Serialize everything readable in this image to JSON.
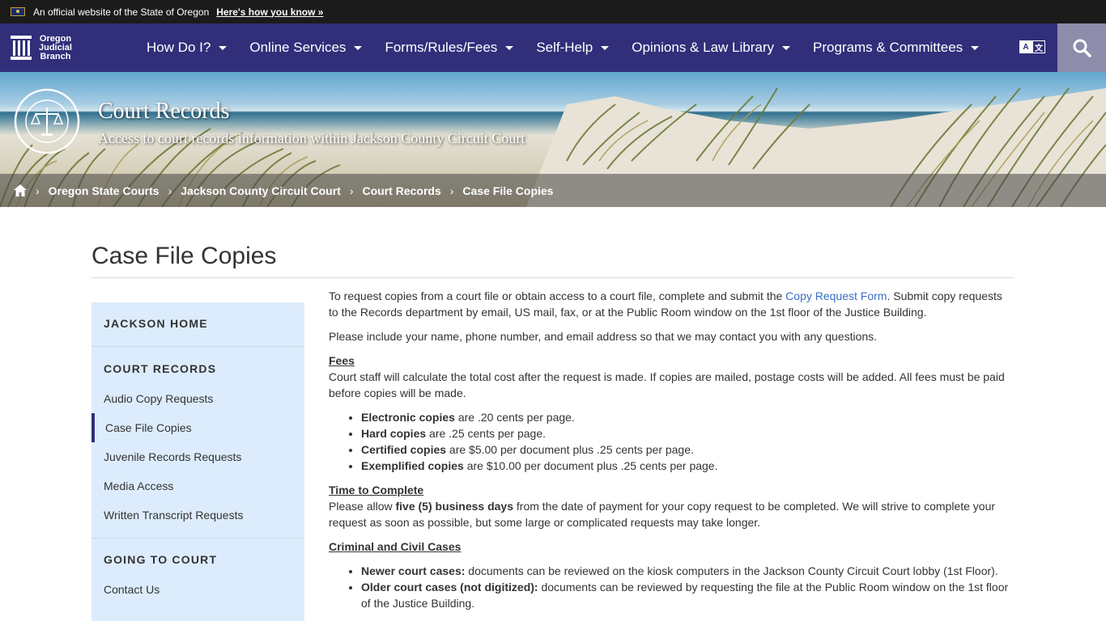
{
  "official": {
    "text": "An official website of the State of Oregon",
    "how": "Here's how you know »"
  },
  "logo": {
    "line1": "Oregon",
    "line2": "Judicial",
    "line3": "Branch"
  },
  "nav": [
    "How Do I?",
    "Online Services",
    "Forms/Rules/Fees",
    "Self-Help",
    "Opinions & Law Library",
    "Programs & Committees"
  ],
  "hero": {
    "title": "Court Records",
    "subtitle": "Access to court records information within Jackson County Circuit Court"
  },
  "breadcrumb": [
    "Oregon State Courts",
    "Jackson County Circuit Court",
    "Court Records",
    "Case File Copies"
  ],
  "page_title": "Case File Copies",
  "sidebar": {
    "home": "JACKSON HOME",
    "court_records": "COURT RECORDS",
    "items": [
      "Audio Copy Requests",
      "Case File Copies",
      "Juvenile Records Requests",
      "Media Access",
      "Written Transcript Requests"
    ],
    "going": "GOING TO COURT",
    "contact": "Contact Us"
  },
  "content": {
    "p1_a": "To request copies from a court file or obtain access to a court file, complete and submit the ",
    "p1_link": "Copy Request Form",
    "p1_b": ". Submit copy requests to the Records department by email, US mail, fax, or at the Public Room window on the 1st floor of the Justice Building.",
    "p2": "Please include your name, phone number, and email address so that we may contact you with any questions.",
    "fees_head": "Fees",
    "fees_text": "Court staff will calculate the total cost after the request is made. If copies are mailed, postage costs will be added. All fees must be paid before copies will be made.",
    "fees": [
      {
        "b": "Electronic copies",
        "t": " are .20 cents per page."
      },
      {
        "b": "Hard copies",
        "t": " are .25 cents per page."
      },
      {
        "b": "Certified copies",
        "t": " are $5.00 per document plus .25 cents per page."
      },
      {
        "b": "Exemplified copies",
        "t": " are $10.00 per document plus .25 cents per page."
      }
    ],
    "time_head": "Time to Complete",
    "time_a": "Please allow ",
    "time_b": "five (5) business days",
    "time_c": " from the date of payment for your copy request to be completed. We will strive to complete your request as soon as possible, but some large or complicated requests may take longer.",
    "cases_head": "Criminal and Civil Cases",
    "cases": [
      {
        "b": "Newer court cases:",
        "t": " documents can be reviewed on the kiosk computers in the Jackson County Circuit Court lobby (1st Floor)."
      },
      {
        "b": "Older court cases (not digitized):",
        "t": " documents can be reviewed by requesting the file at the Public Room window on the 1st floor of the Justice Building."
      }
    ]
  },
  "colors": {
    "nav_bg": "#312f7a",
    "sidebar_bg": "#dcecfc",
    "link": "#3a6ec7"
  }
}
